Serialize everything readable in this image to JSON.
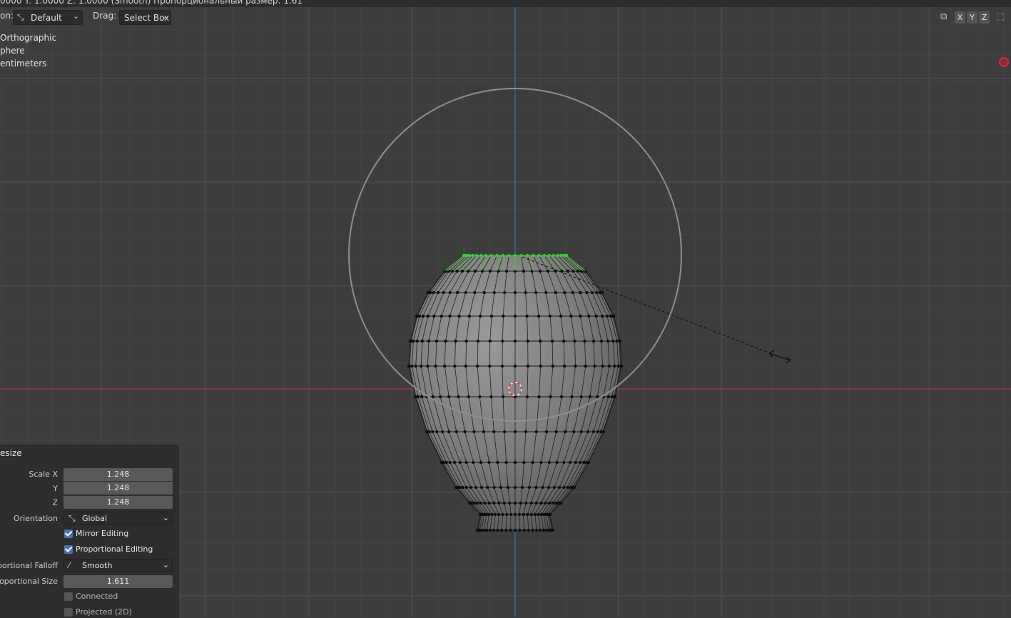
{
  "status_bar": {
    "text": "0000  Y: 1.0000  Z: 1.0000 (Smooth) Пропорциональный размер: 1.61"
  },
  "header": {
    "orientation_label": "on:",
    "orientation_value": "Default",
    "drag_label": "Drag:",
    "drag_value": "Select Box"
  },
  "viewport_info": {
    "line1": " Orthographic",
    "line2": "phere",
    "line3": "entimeters"
  },
  "axis_buttons": [
    "X",
    "Y",
    "Z"
  ],
  "operator_panel": {
    "title": "esize",
    "scale_x_label": "Scale X",
    "scale_x": "1.248",
    "y_label": "Y",
    "scale_y": "1.248",
    "z_label": "Z",
    "scale_z": "1.248",
    "orientation_label": "Orientation",
    "orientation_value": "Global",
    "mirror_editing_label": "Mirror Editing",
    "mirror_editing": true,
    "proportional_editing_label": "Proportional Editing",
    "proportional_editing": true,
    "falloff_label": "oportional Falloff",
    "falloff_value": "Smooth",
    "prop_size_label": "Proportional Size",
    "prop_size": "1.611",
    "connected_label": "Connected",
    "connected": false,
    "projected_label": "Projected (2D)",
    "projected": false
  },
  "colors": {
    "background": "#3d3d3d",
    "x_axis": "#c4363f",
    "y_axis": "#4b78c2",
    "selected_vertices": "#3cc83c",
    "checkbox_accent": "#4772b3"
  }
}
